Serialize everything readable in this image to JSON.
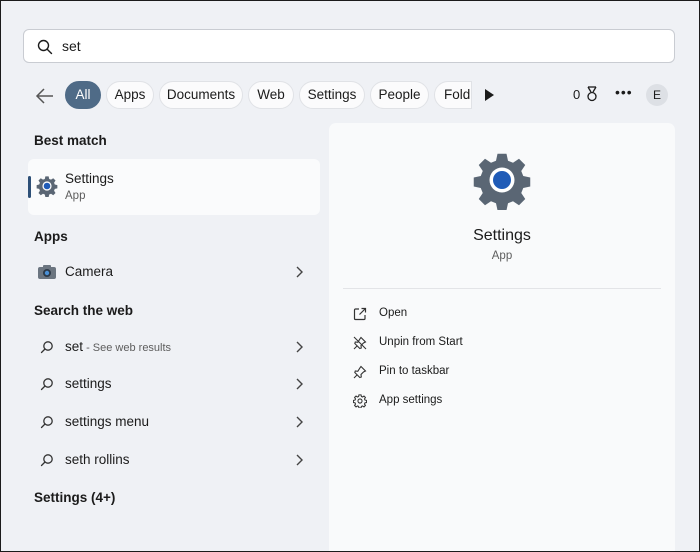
{
  "search": {
    "value": "set"
  },
  "filters": {
    "tabs": [
      "All",
      "Apps",
      "Documents",
      "Web",
      "Settings",
      "People",
      "Fold"
    ],
    "active_index": 0,
    "points": "0",
    "avatar_initial": "E"
  },
  "left": {
    "best_match_heading": "Best match",
    "best_match": {
      "title": "Settings",
      "subtitle": "App",
      "icon": "gear-icon"
    },
    "apps_heading": "Apps",
    "apps": [
      {
        "label": "Camera",
        "icon": "camera-icon"
      }
    ],
    "web_heading": "Search the web",
    "web": [
      {
        "label": "set",
        "sub": " - See web results"
      },
      {
        "label": "settings"
      },
      {
        "label": "settings menu"
      },
      {
        "label": "seth rollins"
      }
    ],
    "settings_more": "Settings (4+)"
  },
  "preview": {
    "title": "Settings",
    "subtitle": "App",
    "actions": [
      {
        "label": "Open",
        "icon": "open-icon"
      },
      {
        "label": "Unpin from Start",
        "icon": "unpin-icon"
      },
      {
        "label": "Pin to taskbar",
        "icon": "pin-icon"
      },
      {
        "label": "App settings",
        "icon": "settings-gear-icon"
      }
    ]
  },
  "colors": {
    "accent": "#4f6b87",
    "gear": "#5a6674",
    "gear_center": "#1f5bb7"
  }
}
